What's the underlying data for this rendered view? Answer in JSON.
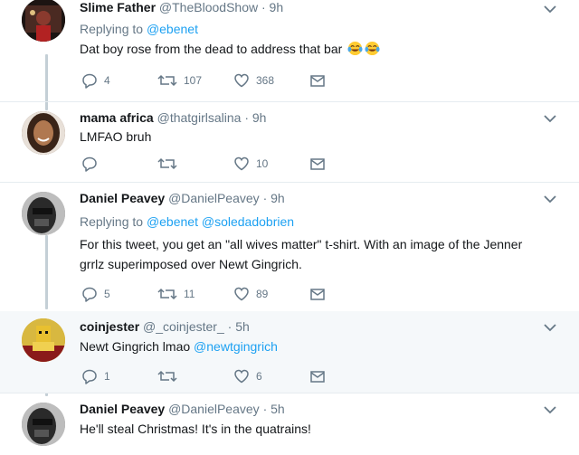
{
  "tweets": [
    {
      "name": "Slime Father",
      "handle": "@TheBloodShow",
      "time": "9h",
      "replying_prefix": "Replying to",
      "replying_to": [
        "@ebenet"
      ],
      "text": "Dat boy rose from the dead to address that bar",
      "emoji": [
        "face-with-tears-of-joy",
        "face-with-tears-of-joy"
      ],
      "replies": "4",
      "retweets": "107",
      "likes": "368"
    },
    {
      "name": "mama africa",
      "handle": "@thatgirlsalina",
      "time": "9h",
      "text": "LMFAO bruh",
      "replies": "",
      "retweets": "",
      "likes": "10"
    },
    {
      "name": "Daniel Peavey",
      "handle": "@DanielPeavey",
      "time": "9h",
      "replying_prefix": "Replying to",
      "replying_to": [
        "@ebenet",
        "@soledadobrien"
      ],
      "text_line1": "For this tweet, you get an \"all wives matter\" t-shirt. With an image of the Jenner",
      "text_line2": "grrlz superimposed over Newt Gingrich.",
      "replies": "5",
      "retweets": "11",
      "likes": "89"
    },
    {
      "name": "coinjester",
      "handle": "@_coinjester_",
      "time": "5h",
      "text_prefix": "Newt Gingrich lmao",
      "text_mention": "@newtgingrich",
      "replies": "1",
      "retweets": "",
      "likes": "6"
    },
    {
      "name": "Daniel Peavey",
      "handle": "@DanielPeavey",
      "time": "5h",
      "text": "He'll steal Christmas! It's in the quatrains!"
    }
  ],
  "separator": "·",
  "icons": {
    "reply": "reply-icon",
    "retweet": "retweet-icon",
    "like": "heart-icon",
    "dm": "envelope-icon",
    "menu": "chevron-down-icon"
  },
  "colors": {
    "link": "#1da1f2",
    "muted": "#657786",
    "thread_line": "#c4cfd6",
    "highlight_bg": "#f5f8fa"
  }
}
